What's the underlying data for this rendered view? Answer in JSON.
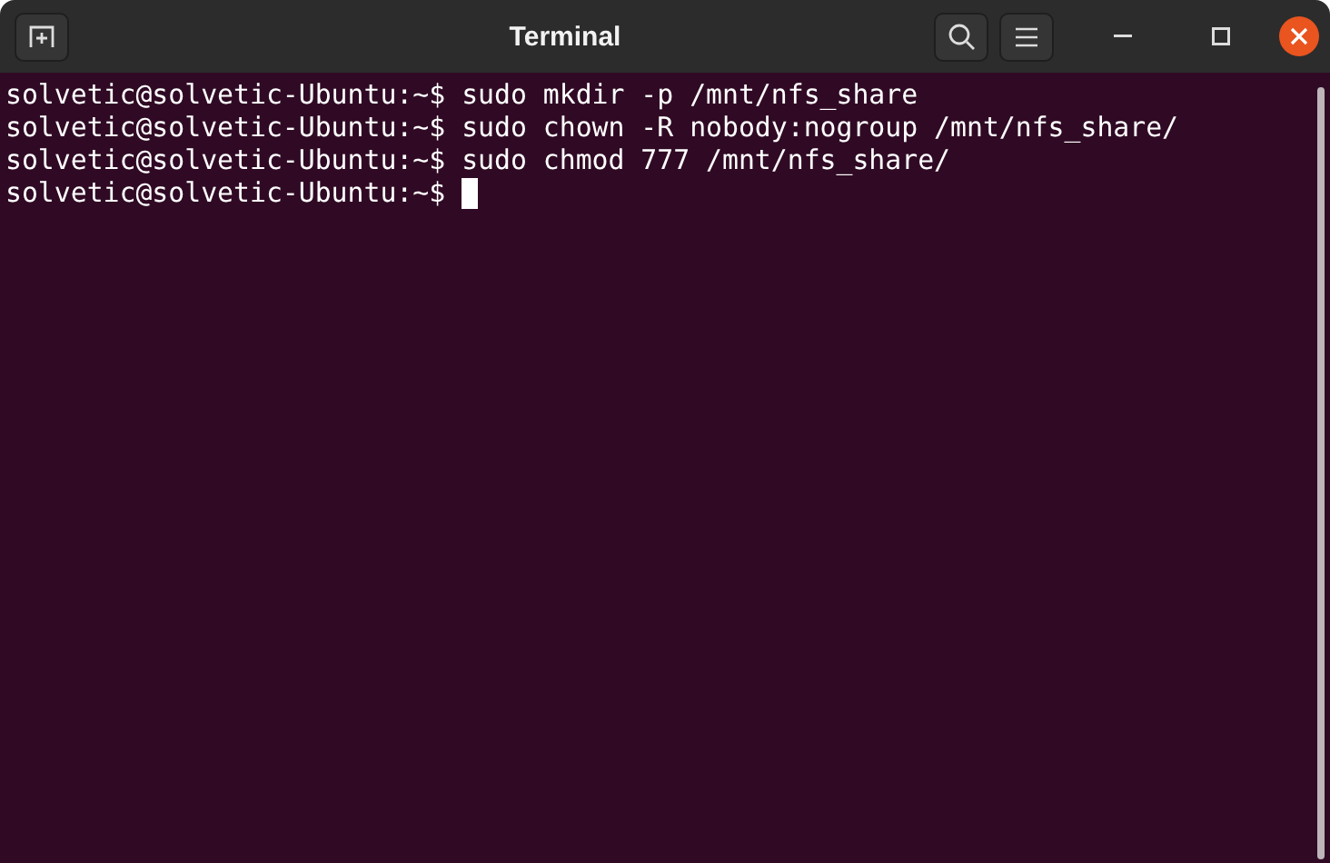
{
  "window": {
    "title": "Terminal"
  },
  "lines": [
    {
      "prompt": "solvetic@solvetic-Ubuntu:~$",
      "command": "sudo mkdir -p /mnt/nfs_share",
      "cursor": false
    },
    {
      "prompt": "solvetic@solvetic-Ubuntu:~$",
      "command": "sudo chown -R nobody:nogroup /mnt/nfs_share/",
      "cursor": false
    },
    {
      "prompt": "solvetic@solvetic-Ubuntu:~$",
      "command": "sudo chmod 777 /mnt/nfs_share/",
      "cursor": false
    },
    {
      "prompt": "solvetic@solvetic-Ubuntu:~$",
      "cursor": true
    }
  ]
}
